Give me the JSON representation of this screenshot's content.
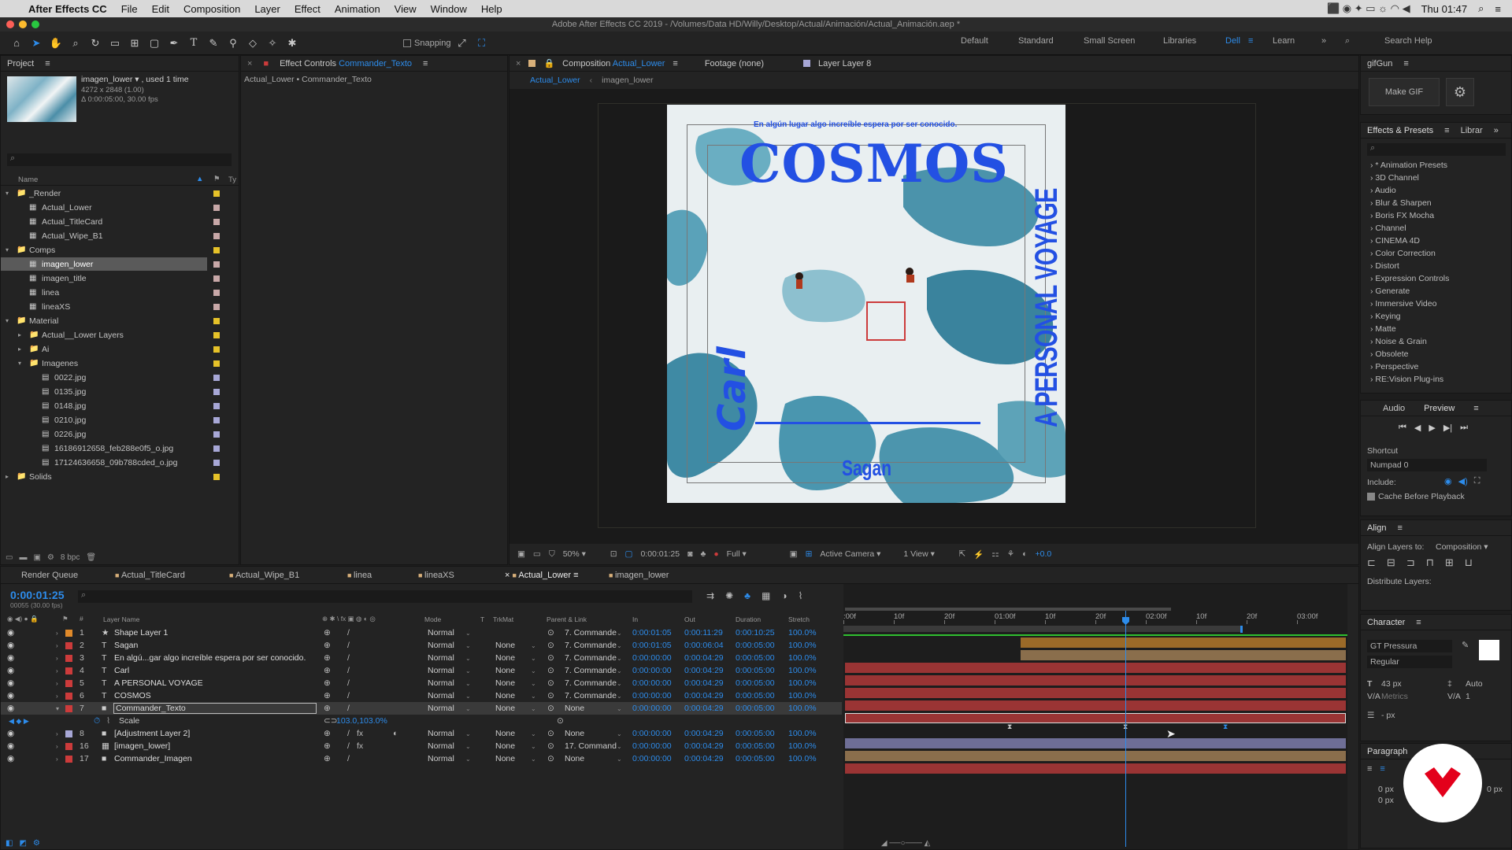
{
  "menubar": {
    "apple": "",
    "app": "After Effects CC",
    "items": [
      "File",
      "Edit",
      "Composition",
      "Layer",
      "Effect",
      "Animation",
      "View",
      "Window",
      "Help"
    ],
    "clock": "Thu 01:47"
  },
  "window_title": "Adobe After Effects CC 2019 - /Volumes/Data HD/Willy/Desktop/Actual/Animación/Actual_Animación.aep *",
  "toolbar": {
    "snapping": "Snapping",
    "workspaces": [
      "Default",
      "Standard",
      "Small Screen",
      "Libraries",
      "Dell",
      "Learn"
    ],
    "search": "Search Help"
  },
  "project": {
    "title": "Project",
    "footage_name": "imagen_lower ▾ , used 1 time",
    "footage_dims": "4272 x 2848 (1.00)",
    "footage_dur": "Δ 0:00:05:00, 30.00 fps",
    "col_name": "Name",
    "col_type": "Ty",
    "bpc": "8 bpc",
    "tree": [
      {
        "label": "_Render",
        "indent": 0,
        "type": "folder",
        "open": true,
        "swatch": "#e6c229"
      },
      {
        "label": "Actual_Lower",
        "indent": 1,
        "type": "comp",
        "swatch": "#c8a8a8"
      },
      {
        "label": "Actual_TitleCard",
        "indent": 1,
        "type": "comp",
        "swatch": "#c8a8a8"
      },
      {
        "label": "Actual_Wipe_B1",
        "indent": 1,
        "type": "comp",
        "swatch": "#c8a8a8"
      },
      {
        "label": "Comps",
        "indent": 0,
        "type": "folder",
        "open": true,
        "swatch": "#e6c229"
      },
      {
        "label": "imagen_lower",
        "indent": 1,
        "type": "comp",
        "swatch": "#c8a8a8",
        "selected": true
      },
      {
        "label": "imagen_title",
        "indent": 1,
        "type": "comp",
        "swatch": "#c8a8a8"
      },
      {
        "label": "linea",
        "indent": 1,
        "type": "comp",
        "swatch": "#c8a8a8"
      },
      {
        "label": "lineaXS",
        "indent": 1,
        "type": "comp",
        "swatch": "#c8a8a8"
      },
      {
        "label": "Material",
        "indent": 0,
        "type": "folder",
        "open": true,
        "swatch": "#e6c229"
      },
      {
        "label": "Actual__Lower Layers",
        "indent": 1,
        "type": "folder",
        "open": false,
        "swatch": "#e6c229"
      },
      {
        "label": "Ai",
        "indent": 1,
        "type": "folder",
        "open": false,
        "swatch": "#e6c229"
      },
      {
        "label": "Imagenes",
        "indent": 1,
        "type": "folder",
        "open": true,
        "swatch": "#e6c229"
      },
      {
        "label": "0022.jpg",
        "indent": 2,
        "type": "file",
        "swatch": "#a7a7d6"
      },
      {
        "label": "0135.jpg",
        "indent": 2,
        "type": "file",
        "swatch": "#a7a7d6"
      },
      {
        "label": "0148.jpg",
        "indent": 2,
        "type": "file",
        "swatch": "#a7a7d6"
      },
      {
        "label": "0210.jpg",
        "indent": 2,
        "type": "file",
        "swatch": "#a7a7d6"
      },
      {
        "label": "0226.jpg",
        "indent": 2,
        "type": "file",
        "swatch": "#a7a7d6"
      },
      {
        "label": "16186912658_feb288e0f5_o.jpg",
        "indent": 2,
        "type": "file",
        "swatch": "#a7a7d6"
      },
      {
        "label": "17124636658_09b788cded_o.jpg",
        "indent": 2,
        "type": "file",
        "swatch": "#a7a7d6"
      },
      {
        "label": "Solids",
        "indent": 0,
        "type": "folder",
        "open": false,
        "swatch": "#e6c229"
      }
    ]
  },
  "effect_controls": {
    "title": "Effect Controls",
    "layer": "Commander_Texto",
    "breadcrumb": "Actual_Lower • Commander_Texto"
  },
  "composition": {
    "title": "Composition",
    "name": "Actual_Lower",
    "footage_tab": "Footage (none)",
    "layer_tab": "Layer Layer 8",
    "nav": [
      "Actual_Lower",
      "imagen_lower"
    ],
    "texts": {
      "tagline": "En algún lugar algo increíble espera por ser conocido.",
      "cosmos": "COSMOS",
      "carl": "Carl",
      "voyage": "A PERSONAL VOYAGE",
      "sagan": "Sagan"
    },
    "zoom": "50%",
    "timecode": "0:00:01:25",
    "resolution": "Full",
    "camera": "Active Camera",
    "views": "1 View",
    "exposure": "+0.0"
  },
  "right": {
    "gifgun": "gifGun",
    "make_gif": "Make GIF",
    "effects_tab": "Effects & Presets",
    "libraries_tab": "Librar",
    "effects": [
      "* Animation Presets",
      "3D Channel",
      "Audio",
      "Blur & Sharpen",
      "Boris FX Mocha",
      "Channel",
      "CINEMA 4D",
      "Color Correction",
      "Distort",
      "Expression Controls",
      "Generate",
      "Immersive Video",
      "Keying",
      "Matte",
      "Noise & Grain",
      "Obsolete",
      "Perspective",
      "RE:Vision Plug-ins"
    ],
    "audio_tab": "Audio",
    "preview_tab": "Preview",
    "shortcut": "Shortcut",
    "shortcut_val": "Numpad 0",
    "include": "Include:",
    "cache": "Cache Before Playback",
    "align": "Align",
    "align_to": "Align Layers to:",
    "align_to_val": "Composition",
    "distribute": "Distribute Layers:",
    "character": "Character",
    "font": "GT Pressura",
    "style": "Regular",
    "size": "43 px",
    "leading": "Auto",
    "kerning": "Metrics",
    "tracking": "1",
    "stroke": "- px",
    "paragraph": "Paragraph",
    "indent1": "0 px",
    "indent2": "0 px",
    "indent3": "0 px"
  },
  "timeline": {
    "render_queue": "Render Queue",
    "tabs": [
      "Actual_TitleCard",
      "Actual_Wipe_B1",
      "linea",
      "lineaXS",
      "Actual_Lower",
      "imagen_lower"
    ],
    "timecode": "0:00:01:25",
    "frames": "00055 (30.00 fps)",
    "headers": {
      "name": "Layer Name",
      "mode": "Mode",
      "t": "T",
      "trkmat": "TrkMat",
      "parent": "Parent & Link",
      "in": "In",
      "out": "Out",
      "duration": "Duration",
      "stretch": "Stretch"
    },
    "ruler": [
      ":00f",
      "10f",
      "20f",
      "01:00f",
      "10f",
      "20f",
      "02:00f",
      "10f",
      "20f",
      "03:00f"
    ],
    "layers": [
      {
        "num": "1",
        "name": "Shape Layer 1",
        "type": "shape",
        "color": "#e08a2a",
        "mode": "Normal",
        "trkmat": "",
        "parent": "7. Commande",
        "in": "0:00:01:05",
        "out": "0:00:11:29",
        "dur": "0:00:10:25",
        "stretch": "100.0%",
        "bar": "orange"
      },
      {
        "num": "2",
        "name": "Sagan",
        "type": "text",
        "color": "#cc3b3b",
        "mode": "Normal",
        "trkmat": "None",
        "parent": "7. Commande",
        "in": "0:00:01:05",
        "out": "0:00:06:04",
        "dur": "0:00:05:00",
        "stretch": "100.0%",
        "bar": "tan"
      },
      {
        "num": "3",
        "name": "En algú...gar algo increíble espera por ser conocido.",
        "type": "text",
        "color": "#cc3b3b",
        "mode": "Normal",
        "trkmat": "None",
        "parent": "7. Commande",
        "in": "0:00:00:00",
        "out": "0:00:04:29",
        "dur": "0:00:05:00",
        "stretch": "100.0%",
        "bar": "red"
      },
      {
        "num": "4",
        "name": "Carl",
        "type": "text",
        "color": "#cc3b3b",
        "mode": "Normal",
        "trkmat": "None",
        "parent": "7. Commande",
        "in": "0:00:00:00",
        "out": "0:00:04:29",
        "dur": "0:00:05:00",
        "stretch": "100.0%",
        "bar": "red"
      },
      {
        "num": "5",
        "name": "A PERSONAL VOYAGE",
        "type": "text",
        "color": "#cc3b3b",
        "mode": "Normal",
        "trkmat": "None",
        "parent": "7. Commande",
        "in": "0:00:00:00",
        "out": "0:00:04:29",
        "dur": "0:00:05:00",
        "stretch": "100.0%",
        "bar": "red"
      },
      {
        "num": "6",
        "name": "COSMOS",
        "type": "text",
        "color": "#cc3b3b",
        "mode": "Normal",
        "trkmat": "None",
        "parent": "7. Commande",
        "in": "0:00:00:00",
        "out": "0:00:04:29",
        "dur": "0:00:05:00",
        "stretch": "100.0%",
        "bar": "red"
      },
      {
        "num": "7",
        "name": "Commander_Texto",
        "type": "solid",
        "color": "#cc3b3b",
        "mode": "Normal",
        "trkmat": "None",
        "parent": "None",
        "in": "0:00:00:00",
        "out": "0:00:04:29",
        "dur": "0:00:05:00",
        "stretch": "100.0%",
        "bar": "red",
        "selected": true
      },
      {
        "num": "8",
        "name": "[Adjustment Layer 2]",
        "type": "solid",
        "color": "#a7a7d6",
        "mode": "Normal",
        "trkmat": "None",
        "parent": "None",
        "in": "0:00:00:00",
        "out": "0:00:04:29",
        "dur": "0:00:05:00",
        "stretch": "100.0%",
        "bar": "lav"
      },
      {
        "num": "16",
        "name": "[imagen_lower]",
        "type": "comp",
        "color": "#cc3b3b",
        "mode": "Normal",
        "trkmat": "None",
        "parent": "17. Command",
        "in": "0:00:00:00",
        "out": "0:00:04:29",
        "dur": "0:00:05:00",
        "stretch": "100.0%",
        "bar": "tan"
      },
      {
        "num": "17",
        "name": "Commander_Imagen",
        "type": "solid",
        "color": "#cc3b3b",
        "mode": "Normal",
        "trkmat": "None",
        "parent": "None",
        "in": "0:00:00:00",
        "out": "0:00:04:29",
        "dur": "0:00:05:00",
        "stretch": "100.0%",
        "bar": "red"
      }
    ],
    "scale_prop": "Scale",
    "scale_val": "103.0,103.0%"
  }
}
